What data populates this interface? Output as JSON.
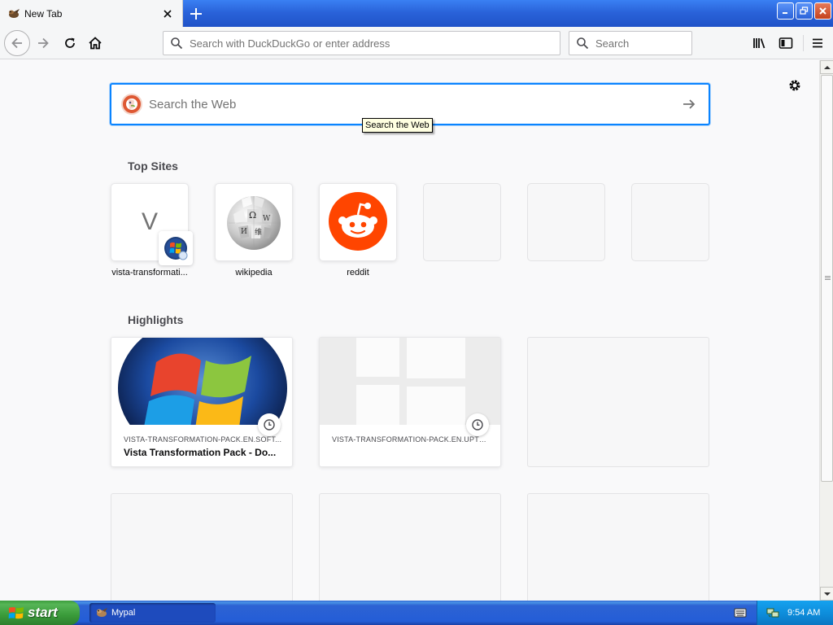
{
  "browser": {
    "tab_title": "New Tab",
    "url_placeholder": "Search with DuckDuckGo or enter address",
    "search_placeholder": "Search"
  },
  "newtab": {
    "web_search_placeholder": "Search the Web",
    "tooltip": "Search the Web",
    "top_sites_heading": "Top Sites",
    "top_sites": [
      {
        "label": "vista-transformati...",
        "letter": "V"
      },
      {
        "label": "wikipedia"
      },
      {
        "label": "reddit"
      }
    ],
    "highlights_heading": "Highlights",
    "highlights": [
      {
        "host": "VISTA-TRANSFORMATION-PACK.EN.SOFT...",
        "title": "Vista Transformation Pack - Do..."
      },
      {
        "host": "VISTA-TRANSFORMATION-PACK.EN.UPTO..."
      }
    ]
  },
  "taskbar": {
    "start_label": "start",
    "task_label": "Mypal",
    "clock": "9:54 AM"
  },
  "colors": {
    "accent_blue": "#0a84ff",
    "reddit_orange": "#ff4500",
    "ddg_orange": "#de5833",
    "xp_start_green": "#3a9b3a",
    "xp_taskbar_blue": "#245dd7"
  },
  "icons": [
    "mypal-icon",
    "close-icon",
    "plus-icon",
    "minimize-icon",
    "restore-icon",
    "window-close-icon",
    "back-arrow-icon",
    "forward-arrow-icon",
    "reload-icon",
    "home-icon",
    "search-icon",
    "library-icon",
    "sidebar-icon",
    "hamburger-menu-icon",
    "gear-icon",
    "duckduckgo-icon",
    "arrow-right-icon",
    "windows-logo-icon",
    "wikipedia-globe-icon",
    "reddit-icon",
    "clock-icon",
    "keyboard-icon",
    "network-icon"
  ]
}
